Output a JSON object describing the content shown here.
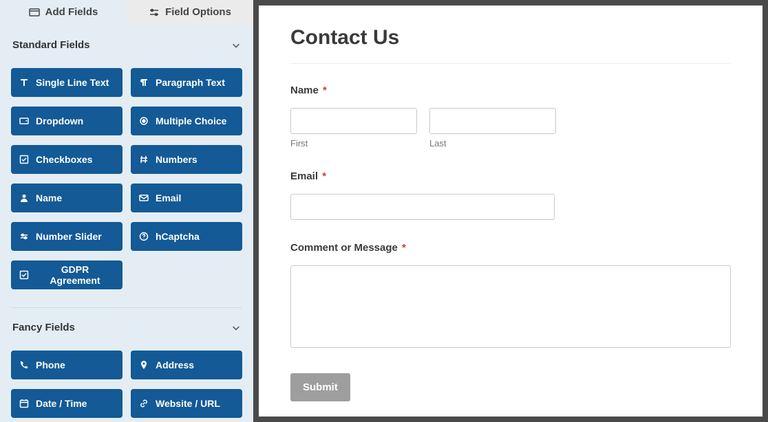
{
  "sidebar": {
    "tabs": {
      "add_fields": "Add Fields",
      "field_options": "Field Options"
    },
    "sections": [
      {
        "title": "Standard Fields",
        "items": [
          "Single Line Text",
          "Paragraph Text",
          "Dropdown",
          "Multiple Choice",
          "Checkboxes",
          "Numbers",
          "Name",
          "Email",
          "Number Slider",
          "hCaptcha",
          "GDPR Agreement"
        ]
      },
      {
        "title": "Fancy Fields",
        "items": [
          "Phone",
          "Address",
          "Date / Time",
          "Website / URL"
        ]
      }
    ]
  },
  "preview": {
    "title": "Contact Us",
    "name": {
      "label": "Name",
      "first": "First",
      "last": "Last"
    },
    "email": {
      "label": "Email"
    },
    "comment": {
      "label": "Comment or Message"
    },
    "submit": "Submit",
    "required_marker": "*"
  }
}
